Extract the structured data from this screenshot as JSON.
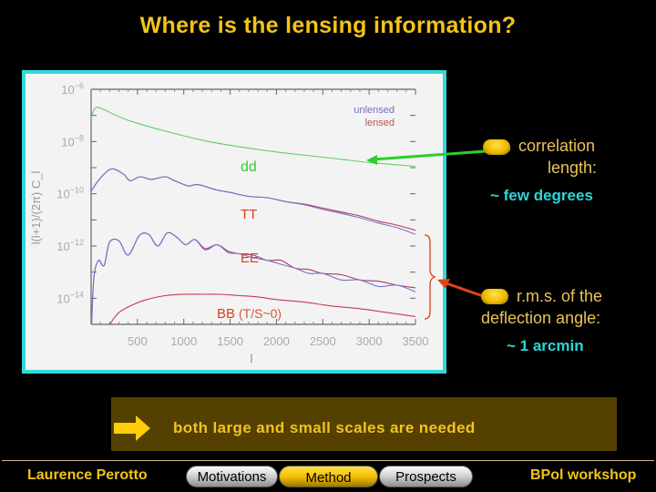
{
  "slide": {
    "title": "Where is the lensing information?",
    "callouts": [
      {
        "id": "correlation",
        "text_line1": "correlation",
        "text_line2": "length:",
        "value": "~ few degrees",
        "pointer_color": "#2ecc2e"
      },
      {
        "id": "deflection",
        "text_line1": "r.m.s. of the",
        "text_line2": "deflection angle:",
        "value": "~ 1 arcmin",
        "pointer_color": "#e0441a"
      }
    ],
    "banner": {
      "icon": "right-arrow-icon",
      "text": "both large and small scales are needed"
    },
    "footer": {
      "author": "Laurence Perotto",
      "event": "BPol workshop",
      "nav": [
        {
          "label": "Motivations",
          "active": false
        },
        {
          "label": "Method",
          "active": true
        },
        {
          "label": "Prospects",
          "active": false
        }
      ]
    },
    "colors": {
      "title": "#f2c416",
      "frame": "#33d9d9",
      "callout_text": "#e9c35a",
      "callout_value": "#2fd5d8",
      "banner_bg": "#544000"
    }
  },
  "chart_data": {
    "type": "line",
    "title": "",
    "xlabel": "l",
    "ylabel": "l(l+1)/(2π) C_l",
    "xlim": [
      0,
      3500
    ],
    "ylim_log10": [
      -15,
      -6
    ],
    "yscale": "log",
    "x_ticks": [
      500,
      1000,
      1500,
      2000,
      2500,
      3000,
      3500
    ],
    "x_tick_labels": [
      "500",
      "1000",
      "1500",
      "2000",
      "2500",
      "3000",
      "3500"
    ],
    "y_ticks_log10": [
      -6,
      -8,
      -10,
      -12,
      -14
    ],
    "y_tick_labels": [
      "10^-6",
      "10^-8",
      "10^-10",
      "10^-12",
      "10^-14"
    ],
    "legend": {
      "position": "top-right",
      "entries": [
        {
          "name": "unlensed",
          "color": "#7070c8"
        },
        {
          "name": "lensed",
          "color": "#c85050"
        }
      ]
    },
    "series_labels": [
      {
        "name": "dd",
        "sub": "",
        "color": "#33cc33"
      },
      {
        "name": "TT",
        "sub": "",
        "color": "#d9401a"
      },
      {
        "name": "EE",
        "sub": "",
        "color": "#d9401a"
      },
      {
        "name": "BB",
        "sub": "(T/S~0)",
        "color": "#d9401a"
      }
    ],
    "series": [
      {
        "name": "dd",
        "color": "#66cc66",
        "x": [
          0,
          50,
          150,
          300,
          500,
          800,
          1200,
          1600,
          2000,
          2500,
          3000,
          3500
        ],
        "log10_y": [
          -7.1,
          -6.7,
          -6.8,
          -7.05,
          -7.3,
          -7.6,
          -7.95,
          -8.2,
          -8.4,
          -8.6,
          -8.8,
          -8.95
        ]
      },
      {
        "name": "TT lensed",
        "color": "#b03a5a",
        "x": [
          0,
          100,
          220,
          350,
          420,
          530,
          650,
          800,
          900,
          1050,
          1150,
          1350,
          1500,
          1700,
          1900,
          2100,
          2300,
          2500,
          2700,
          2900,
          3100,
          3300,
          3500
        ],
        "log10_y": [
          -9.9,
          -9.4,
          -9.05,
          -9.25,
          -9.5,
          -9.35,
          -9.45,
          -9.35,
          -9.5,
          -9.7,
          -9.65,
          -9.85,
          -9.95,
          -10.1,
          -10.15,
          -10.3,
          -10.4,
          -10.55,
          -10.7,
          -10.85,
          -11.05,
          -11.2,
          -11.4
        ]
      },
      {
        "name": "TT unlensed",
        "color": "#7a6fd0",
        "x": [
          0,
          100,
          220,
          350,
          420,
          530,
          650,
          800,
          900,
          1050,
          1150,
          1350,
          1500,
          1700,
          1900,
          2100,
          2300,
          2500,
          2700,
          2900,
          3100,
          3300,
          3500
        ],
        "log10_y": [
          -9.9,
          -9.4,
          -9.05,
          -9.25,
          -9.5,
          -9.35,
          -9.45,
          -9.35,
          -9.5,
          -9.7,
          -9.65,
          -9.85,
          -9.95,
          -10.1,
          -10.15,
          -10.3,
          -10.42,
          -10.6,
          -10.75,
          -10.92,
          -11.12,
          -11.3,
          -11.55
        ]
      },
      {
        "name": "EE lensed",
        "color": "#b03a5a",
        "x": [
          5,
          30,
          80,
          140,
          200,
          300,
          400,
          520,
          620,
          720,
          820,
          920,
          1020,
          1120,
          1230,
          1360,
          1480,
          1600,
          1750,
          1900,
          2050,
          2200,
          2350,
          2500,
          2700,
          2900,
          3100,
          3300,
          3500
        ],
        "log10_y": [
          -15,
          -13.2,
          -12.55,
          -12.75,
          -11.85,
          -11.8,
          -12.35,
          -11.6,
          -11.55,
          -12.0,
          -11.5,
          -11.65,
          -11.95,
          -11.75,
          -12.1,
          -11.95,
          -12.2,
          -12.3,
          -12.35,
          -12.55,
          -12.55,
          -12.85,
          -12.9,
          -13.05,
          -13.1,
          -13.3,
          -13.35,
          -13.5,
          -13.6
        ]
      },
      {
        "name": "EE unlensed",
        "color": "#7a6fd0",
        "x": [
          5,
          30,
          80,
          140,
          200,
          300,
          400,
          520,
          620,
          720,
          820,
          920,
          1020,
          1120,
          1230,
          1360,
          1480,
          1600,
          1750,
          1900,
          2050,
          2200,
          2350,
          2500,
          2700,
          2900,
          3100,
          3300,
          3500
        ],
        "log10_y": [
          -15,
          -13.2,
          -12.55,
          -12.75,
          -11.85,
          -11.8,
          -12.35,
          -11.6,
          -11.55,
          -12.0,
          -11.5,
          -11.65,
          -11.95,
          -11.75,
          -12.15,
          -11.95,
          -12.25,
          -12.3,
          -12.45,
          -12.55,
          -12.7,
          -12.85,
          -13.05,
          -13.05,
          -13.3,
          -13.3,
          -13.55,
          -13.5,
          -13.75
        ]
      },
      {
        "name": "BB lensed",
        "color": "#c83a4a",
        "x": [
          200,
          300,
          450,
          600,
          800,
          1000,
          1200,
          1400,
          1600,
          1800,
          2000,
          2300,
          2600,
          2900,
          3200,
          3500
        ],
        "log10_y": [
          -15,
          -14.55,
          -14.25,
          -14.05,
          -13.9,
          -13.85,
          -13.85,
          -13.85,
          -13.9,
          -13.95,
          -14.05,
          -14.15,
          -14.3,
          -14.4,
          -14.55,
          -14.7
        ]
      }
    ]
  }
}
